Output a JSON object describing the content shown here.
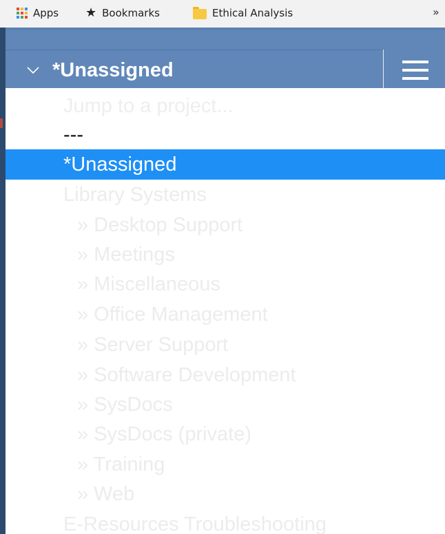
{
  "bookmarks_bar": {
    "apps_label": "Apps",
    "bookmarks_label": "Bookmarks",
    "folder_label": "Ethical Analysis",
    "overflow": "»"
  },
  "header": {
    "chevron": "chevron-down-icon",
    "selected_project": "*Unassigned",
    "menu_icon": "hamburger-menu-icon"
  },
  "dropdown": {
    "placeholder": "Jump to a project...",
    "separator": "---",
    "options": [
      {
        "label": "*Unassigned",
        "selected": true,
        "indent": false
      },
      {
        "label": "Library Systems",
        "selected": false,
        "indent": false
      },
      {
        "label": "» Desktop Support",
        "selected": false,
        "indent": true
      },
      {
        "label": "» Meetings",
        "selected": false,
        "indent": true
      },
      {
        "label": "» Miscellaneous",
        "selected": false,
        "indent": true
      },
      {
        "label": "» Office Management",
        "selected": false,
        "indent": true
      },
      {
        "label": "» Server Support",
        "selected": false,
        "indent": true
      },
      {
        "label": "» Software Development",
        "selected": false,
        "indent": true
      },
      {
        "label": "» SysDocs",
        "selected": false,
        "indent": true
      },
      {
        "label": "» SysDocs (private)",
        "selected": false,
        "indent": true
      },
      {
        "label": "» Training",
        "selected": false,
        "indent": true
      },
      {
        "label": "» Web",
        "selected": false,
        "indent": true
      },
      {
        "label": "E-Resources Troubleshooting",
        "selected": false,
        "indent": false
      }
    ]
  },
  "colors": {
    "header_bg": "#6187b8",
    "selected_bg": "#1e8ff5",
    "option_text": "#ececec",
    "apps_grid": [
      "#e8453c",
      "#f9bb2d",
      "#3a8ef6",
      "#4aa954"
    ]
  }
}
